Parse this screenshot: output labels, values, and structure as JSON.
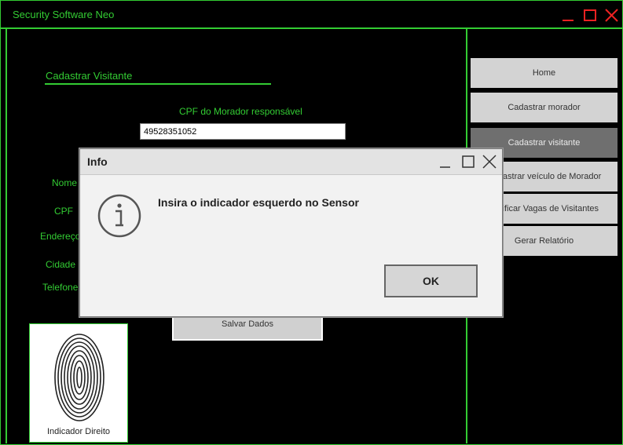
{
  "window": {
    "title": "Security Software Neo",
    "accent_color": "#33cc33",
    "control_color": "#ee2222"
  },
  "form": {
    "section_title": "Cadastrar Visitante",
    "cpf_morador_label": "CPF do Morador responsável",
    "cpf_morador_value": "49528351052",
    "fields": {
      "nome": "Nome",
      "cpf": "CPF",
      "endereco": "Endereço",
      "cidade": "Cidade",
      "telefone": "Telefone"
    },
    "save_label": "Salvar Dados"
  },
  "fingerprint": {
    "label": "Indicador Direito",
    "icon": "fingerprint-image"
  },
  "nav": {
    "items": [
      {
        "label": "Home",
        "active": false
      },
      {
        "label": "Cadastrar morador",
        "active": false
      },
      {
        "label": "Cadastrar visitante",
        "active": true
      },
      {
        "label": "Cadastrar veículo de Morador",
        "active": false
      },
      {
        "label": "Verificar Vagas de Visitantes",
        "active": false
      },
      {
        "label": "Gerar Relatório",
        "active": false
      }
    ]
  },
  "dialog": {
    "title": "Info",
    "message": "Insira o indicador esquerdo no Sensor",
    "ok_label": "OK",
    "icon": "info-icon"
  }
}
